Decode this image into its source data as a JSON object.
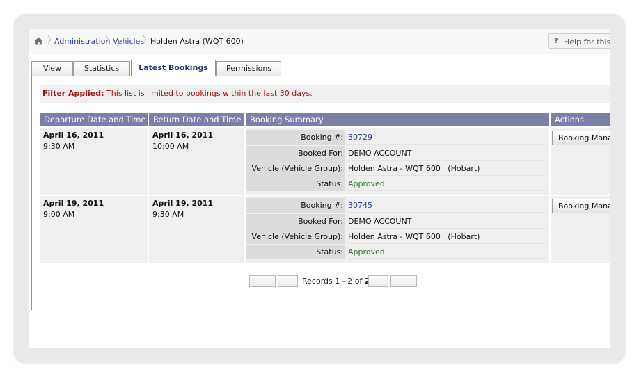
{
  "breadcrumb": {
    "home_icon": "home-icon",
    "items": [
      "Administration",
      "Vehicles",
      "Holden Astra (WQT 600)"
    ]
  },
  "help": {
    "icon": "?",
    "label": "Help for this p"
  },
  "tabs": [
    {
      "label": "View",
      "active": false
    },
    {
      "label": "Statistics",
      "active": false
    },
    {
      "label": "Latest Bookings",
      "active": true
    },
    {
      "label": "Permissions",
      "active": false
    }
  ],
  "filter": {
    "label": "Filter Applied:",
    "text": "This list is limited to bookings within the last 30 days."
  },
  "table": {
    "headers": [
      "Departure Date and Time",
      "Return Date and Time",
      "Booking Summary",
      "Actions"
    ],
    "summary_labels": [
      "Booking #:",
      "Booked For:",
      "Vehicle (Vehicle Group):",
      "Status:"
    ],
    "rows": [
      {
        "dep_date": "April 16, 2011",
        "dep_time": "9:30 AM",
        "ret_date": "April 16, 2011",
        "ret_time": "10:00 AM",
        "booking_no": "30729",
        "booked_for": "DEMO ACCOUNT",
        "vehicle": "Holden Astra - WQT 600   (Hobart)",
        "status": "Approved",
        "action": "Booking Manag"
      },
      {
        "dep_date": "April 19, 2011",
        "dep_time": "9:00 AM",
        "ret_date": "April 19, 2011",
        "ret_time": "9:30 AM",
        "booking_no": "30745",
        "booked_for": "DEMO ACCOUNT",
        "vehicle": "Holden Astra - WQT 600   (Hobart)",
        "status": "Approved",
        "action": "Booking Manag"
      }
    ]
  },
  "pager": {
    "text": "Records 1 - 2 of",
    "total": "2"
  },
  "colors": {
    "header": "#7c80a8",
    "link": "#2a3f8f",
    "approved": "#1f7a26",
    "filter": "#a01515"
  }
}
